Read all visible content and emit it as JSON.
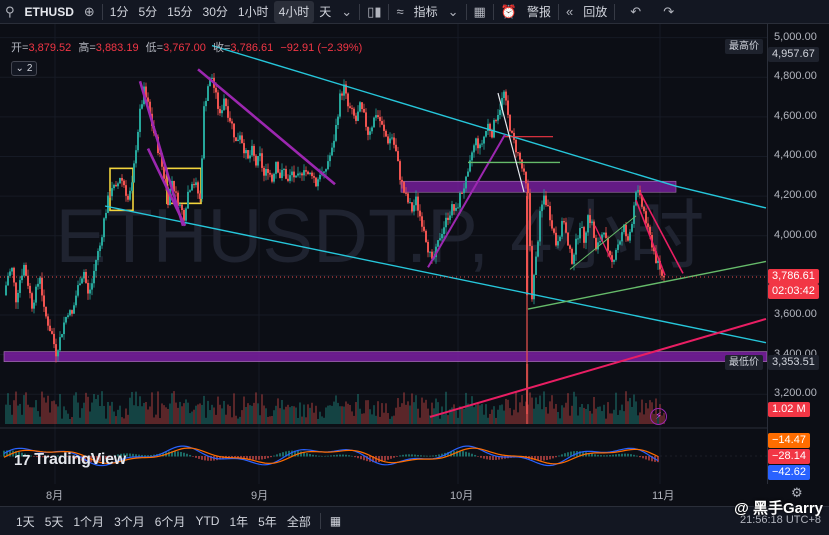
{
  "toolbar": {
    "symbol": "ETHUSD",
    "intervals": [
      "1分",
      "5分",
      "15分",
      "30分",
      "1小时",
      "4小时",
      "天"
    ],
    "active_interval": "4小时",
    "indicators_label": "指标",
    "alert_label": "警报",
    "replay_label": "回放",
    "icons": [
      "search-icon",
      "plus-icon",
      "candles-icon",
      "indicators-icon",
      "layout-icon",
      "alert-icon",
      "replay-icon",
      "undo-icon",
      "redo-icon"
    ]
  },
  "ohlc": {
    "open_label": "开=",
    "open": "3,879.52",
    "high_label": "高=",
    "high": "3,883.19",
    "low_label": "低=",
    "low": "3,767.00",
    "close_label": "收=",
    "close": "3,786.61",
    "change": "−92.91 (−2.39%)"
  },
  "indicator_toggle": "2",
  "watermark": "ETHUSDT.P, 4小时",
  "tv_logo": "TradingView",
  "user_watermark": "@ 黑手Garry",
  "clock": "21:56:18 UTC+8",
  "bottombar": {
    "ranges": [
      "1天",
      "5天",
      "1个月",
      "3个月",
      "6个月",
      "YTD",
      "1年",
      "5年",
      "全部"
    ]
  },
  "colors": {
    "up": "#26a69a",
    "down": "#ef5350",
    "channel": "#26c6da",
    "purple": "#9c27b0",
    "zone": "#7b1fa2",
    "trend_red": "#e91e63",
    "support_green": "#66bb6a",
    "yellow_box": "#f2d43d"
  },
  "chart_data": {
    "type": "candlestick",
    "title": "ETHUSDT.P, 4小时",
    "x_labels": [
      "8月",
      "9月",
      "10月",
      "11月"
    ],
    "y_ticks": [
      "5,000.00",
      "4,800.00",
      "4,600.00",
      "4,400.00",
      "4,200.00",
      "4,000.00",
      "3,800.00",
      "3,600.00",
      "3,400.00",
      "3,200.00"
    ],
    "ylim": [
      3100,
      5010
    ],
    "last_price": "3,786.61",
    "countdown": "02:03:42",
    "highest_label": "最高价",
    "highest_price": "4,957.67",
    "lowest_label": "最低价",
    "lowest_price": "3,353.51",
    "volume_label": "1.02 M",
    "macd_values": [
      "−14.47",
      "−28.14",
      "−42.62"
    ],
    "price_path": [
      [
        0,
        3700
      ],
      [
        4,
        3800
      ],
      [
        8,
        3830
      ],
      [
        12,
        3680
      ],
      [
        16,
        3780
      ],
      [
        20,
        3850
      ],
      [
        24,
        3760
      ],
      [
        28,
        3650
      ],
      [
        32,
        3720
      ],
      [
        36,
        3800
      ],
      [
        40,
        3620
      ],
      [
        44,
        3560
      ],
      [
        48,
        3500
      ],
      [
        52,
        3410
      ],
      [
        56,
        3480
      ],
      [
        60,
        3560
      ],
      [
        64,
        3620
      ],
      [
        68,
        3600
      ],
      [
        72,
        3700
      ],
      [
        76,
        3780
      ],
      [
        80,
        3820
      ],
      [
        84,
        3700
      ],
      [
        88,
        3760
      ],
      [
        92,
        3880
      ],
      [
        96,
        3950
      ],
      [
        100,
        4080
      ],
      [
        104,
        4180
      ],
      [
        108,
        4250
      ],
      [
        112,
        4230
      ],
      [
        116,
        4300
      ],
      [
        120,
        4260
      ],
      [
        124,
        4180
      ],
      [
        128,
        4250
      ],
      [
        132,
        4450
      ],
      [
        136,
        4620
      ],
      [
        140,
        4730
      ],
      [
        144,
        4660
      ],
      [
        148,
        4560
      ],
      [
        152,
        4480
      ],
      [
        156,
        4400
      ],
      [
        160,
        4300
      ],
      [
        164,
        4180
      ],
      [
        168,
        4280
      ],
      [
        172,
        4200
      ],
      [
        176,
        4150
      ],
      [
        180,
        4100
      ],
      [
        184,
        4220
      ],
      [
        188,
        4280
      ],
      [
        192,
        4250
      ],
      [
        196,
        4180
      ],
      [
        200,
        4640
      ],
      [
        204,
        4760
      ],
      [
        208,
        4800
      ],
      [
        212,
        4700
      ],
      [
        216,
        4600
      ],
      [
        220,
        4700
      ],
      [
        224,
        4620
      ],
      [
        228,
        4560
      ],
      [
        232,
        4470
      ],
      [
        236,
        4520
      ],
      [
        240,
        4440
      ],
      [
        244,
        4380
      ],
      [
        248,
        4430
      ],
      [
        252,
        4360
      ],
      [
        256,
        4400
      ],
      [
        260,
        4300
      ],
      [
        264,
        4340
      ],
      [
        268,
        4280
      ],
      [
        272,
        4380
      ],
      [
        276,
        4300
      ],
      [
        280,
        4330
      ],
      [
        284,
        4270
      ],
      [
        288,
        4320
      ],
      [
        292,
        4280
      ],
      [
        296,
        4300
      ],
      [
        300,
        4350
      ],
      [
        304,
        4300
      ],
      [
        308,
        4320
      ],
      [
        312,
        4260
      ],
      [
        316,
        4320
      ],
      [
        320,
        4300
      ],
      [
        324,
        4380
      ],
      [
        328,
        4430
      ],
      [
        332,
        4550
      ],
      [
        336,
        4700
      ],
      [
        340,
        4750
      ],
      [
        344,
        4650
      ],
      [
        348,
        4620
      ],
      [
        352,
        4580
      ],
      [
        356,
        4650
      ],
      [
        360,
        4600
      ],
      [
        364,
        4520
      ],
      [
        368,
        4560
      ],
      [
        372,
        4620
      ],
      [
        376,
        4580
      ],
      [
        380,
        4520
      ],
      [
        384,
        4480
      ],
      [
        388,
        4500
      ],
      [
        392,
        4420
      ],
      [
        396,
        4300
      ],
      [
        400,
        4220
      ],
      [
        404,
        4170
      ],
      [
        408,
        4130
      ],
      [
        412,
        4180
      ],
      [
        416,
        4100
      ],
      [
        420,
        4040
      ],
      [
        424,
        3940
      ],
      [
        428,
        3860
      ],
      [
        432,
        3920
      ],
      [
        436,
        4000
      ],
      [
        440,
        4050
      ],
      [
        444,
        4100
      ],
      [
        448,
        4140
      ],
      [
        452,
        4120
      ],
      [
        456,
        4200
      ],
      [
        460,
        4250
      ],
      [
        464,
        4300
      ],
      [
        468,
        4420
      ],
      [
        472,
        4480
      ],
      [
        476,
        4440
      ],
      [
        480,
        4500
      ],
      [
        484,
        4560
      ],
      [
        488,
        4520
      ],
      [
        492,
        4600
      ],
      [
        496,
        4650
      ],
      [
        500,
        4720
      ],
      [
        504,
        4600
      ],
      [
        508,
        4500
      ],
      [
        512,
        4440
      ],
      [
        516,
        4380
      ],
      [
        520,
        4300
      ],
      [
        524,
        4200
      ],
      [
        528,
        3700
      ],
      [
        532,
        3880
      ],
      [
        536,
        4100
      ],
      [
        540,
        4200
      ],
      [
        544,
        4140
      ],
      [
        548,
        4060
      ],
      [
        552,
        3960
      ],
      [
        556,
        4020
      ],
      [
        560,
        4080
      ],
      [
        564,
        3940
      ],
      [
        568,
        3880
      ],
      [
        572,
        3960
      ],
      [
        576,
        4060
      ],
      [
        580,
        3980
      ],
      [
        584,
        4100
      ],
      [
        588,
        4060
      ],
      [
        592,
        3920
      ],
      [
        596,
        3980
      ],
      [
        600,
        4040
      ],
      [
        604,
        3900
      ],
      [
        608,
        3860
      ],
      [
        612,
        3940
      ],
      [
        616,
        3980
      ],
      [
        620,
        4040
      ],
      [
        624,
        3960
      ],
      [
        628,
        4080
      ],
      [
        632,
        4240
      ],
      [
        636,
        4180
      ],
      [
        640,
        4120
      ],
      [
        644,
        4020
      ],
      [
        648,
        3960
      ],
      [
        652,
        3880
      ],
      [
        656,
        3820
      ],
      [
        660,
        3787
      ]
    ]
  }
}
